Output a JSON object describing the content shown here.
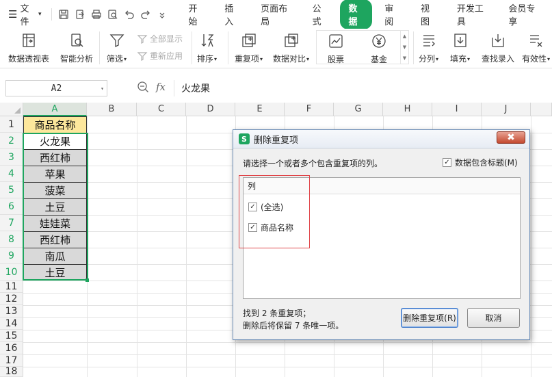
{
  "menubar": {
    "file_label": "文件",
    "tabs": [
      {
        "label": "开始",
        "active": false
      },
      {
        "label": "插入",
        "active": false
      },
      {
        "label": "页面布局",
        "active": false
      },
      {
        "label": "公式",
        "active": false
      },
      {
        "label": "数据",
        "active": true
      },
      {
        "label": "审阅",
        "active": false
      },
      {
        "label": "视图",
        "active": false
      },
      {
        "label": "开发工具",
        "active": false
      },
      {
        "label": "会员专享",
        "active": false
      }
    ]
  },
  "ribbon": {
    "pivot": "数据透视表",
    "analysis": "智能分析",
    "filter": "筛选",
    "show_all": "全部显示",
    "reapply": "重新应用",
    "sort": "排序",
    "duplicates": "重复项",
    "compare": "数据对比",
    "stock": "股票",
    "fund": "基金",
    "split": "分列",
    "fill": "填充",
    "lookup": "查找录入",
    "validity": "有效性"
  },
  "formula": {
    "cell_ref": "A2",
    "content": "火龙果"
  },
  "sheet": {
    "columns": [
      "A",
      "B",
      "C",
      "D",
      "E",
      "F",
      "G",
      "H",
      "I",
      "J"
    ],
    "rows": [
      "1",
      "2",
      "3",
      "4",
      "5",
      "6",
      "7",
      "8",
      "9",
      "10",
      "11",
      "12",
      "13",
      "14",
      "15",
      "16",
      "17",
      "18"
    ],
    "col_a": [
      "商品名称",
      "火龙果",
      "西红柿",
      "苹果",
      "菠菜",
      "土豆",
      "娃娃菜",
      "西红柿",
      "南瓜",
      "土豆"
    ]
  },
  "dialog": {
    "title": "删除重复项",
    "close_glyph": "✖",
    "prompt": "请选择一个或者多个包含重复项的列。",
    "header_checkbox": "数据包含标题(M)",
    "list_header": "列",
    "items": [
      "(全选)",
      "商品名称"
    ],
    "found_line1": "找到 2 条重复项；",
    "found_line2": "删除后将保留 7 条唯一项。",
    "delete_button": "删除重复项(R)",
    "cancel_button": "取消"
  },
  "colors": {
    "accent": "#1ea55f",
    "header_fill": "#fde79c",
    "data_fill": "#d9d9d9",
    "highlight_red": "#e0474b"
  }
}
